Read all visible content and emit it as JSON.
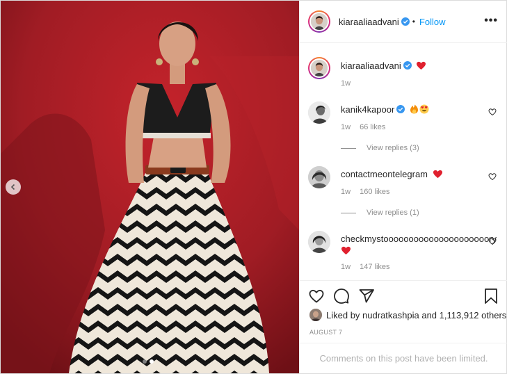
{
  "post": {
    "author": {
      "username": "kiaraaliaadvani",
      "verified": true,
      "follow_label": "Follow",
      "more_icon": "more-horizontal-icon"
    },
    "caption": {
      "username": "kiaraaliaadvani",
      "emoji": "❤️",
      "time": "1w"
    },
    "comments": [
      {
        "username": "kanik4kapoor",
        "verified": true,
        "text": "🔥😍",
        "time": "1w",
        "likes": "66 likes",
        "view_replies": "View replies (3)"
      },
      {
        "username": "contactmeontelegram",
        "verified": false,
        "text": "❤️",
        "time": "1w",
        "likes": "160 likes",
        "view_replies": "View replies (1)"
      },
      {
        "username": "checkmystooooooooooooooooooooory",
        "verified": false,
        "text": "❤️",
        "time": "1w",
        "likes": "147 likes"
      }
    ],
    "actions": {
      "like_icon": "heart-icon",
      "comment_icon": "comment-icon",
      "share_icon": "share-icon",
      "save_icon": "bookmark-icon"
    },
    "liked_by": {
      "prefix": "Liked by",
      "user": "nudratkashpia",
      "joiner": "and",
      "others": "1,113,912 others"
    },
    "date": "AUGUST 7",
    "comments_limited": "Comments on this post have been limited.",
    "carousel": {
      "slides": 2,
      "active_index": 1
    },
    "colors": {
      "link_blue": "#0095f6",
      "verified_blue": "#3897f0",
      "heart_red": "#ed4956",
      "muted_text": "#8e8e8e",
      "photo_background": "#9b1b22"
    }
  }
}
